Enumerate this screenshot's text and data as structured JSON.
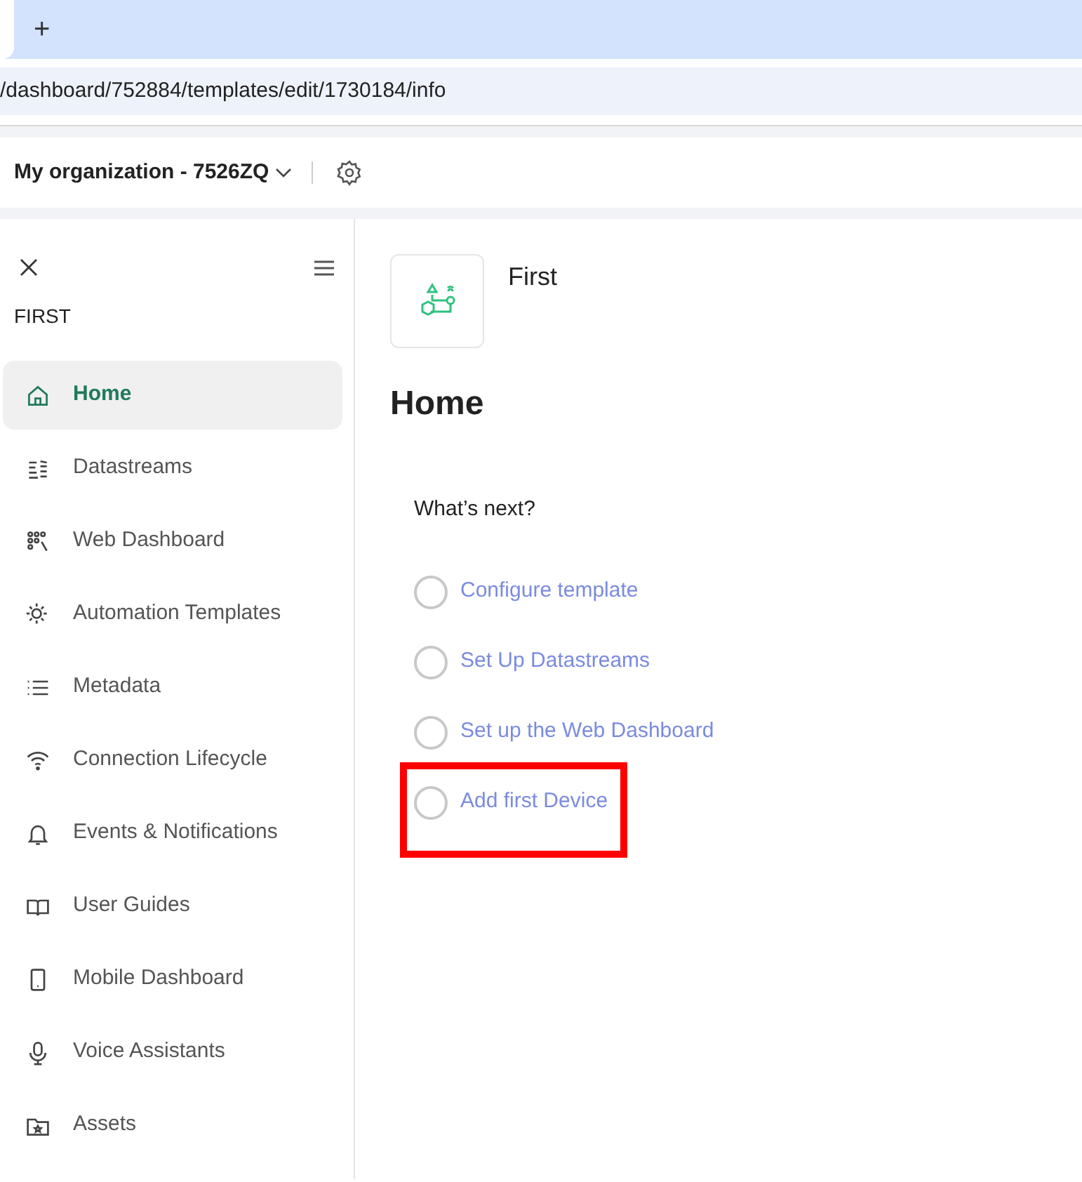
{
  "browser": {
    "new_tab": "+",
    "address": "/dashboard/752884/templates/edit/1730184/info"
  },
  "header": {
    "organization": "My organization - 7526ZQ"
  },
  "sidebar": {
    "title": "FIRST",
    "items": [
      {
        "label": "Home",
        "selected": true
      },
      {
        "label": "Datastreams",
        "selected": false
      },
      {
        "label": "Web Dashboard",
        "selected": false
      },
      {
        "label": "Automation Templates",
        "selected": false
      },
      {
        "label": "Metadata",
        "selected": false
      },
      {
        "label": "Connection Lifecycle",
        "selected": false
      },
      {
        "label": "Events & Notifications",
        "selected": false
      },
      {
        "label": "User Guides",
        "selected": false
      },
      {
        "label": "Mobile Dashboard",
        "selected": false
      },
      {
        "label": "Voice Assistants",
        "selected": false
      },
      {
        "label": "Assets",
        "selected": false
      }
    ]
  },
  "main": {
    "template_name": "First",
    "heading": "Home",
    "next_title": "What’s next?",
    "steps": [
      {
        "label": "Configure template",
        "checked": false,
        "highlighted": false
      },
      {
        "label": "Set Up Datastreams",
        "checked": false,
        "highlighted": false
      },
      {
        "label": "Set up the Web Dashboard",
        "checked": false,
        "highlighted": false
      },
      {
        "label": "Add first Device",
        "checked": false,
        "highlighted": true
      }
    ]
  }
}
